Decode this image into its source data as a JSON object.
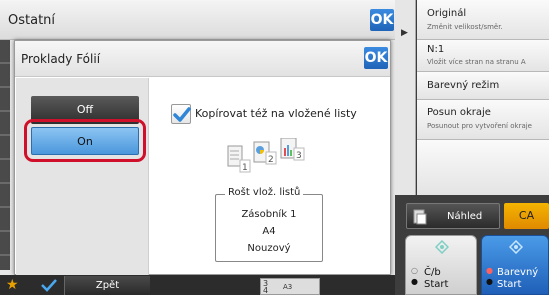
{
  "background_window": {
    "title": "Ostatní",
    "ok_label": "OK"
  },
  "dialog": {
    "title": "Proklady Fólií",
    "ok_label": "OK",
    "off_label": "Off",
    "on_label": "On",
    "checkbox_label": "Kopírovat též na vložené listy",
    "sheet_numbers": [
      "1",
      "2",
      "3"
    ],
    "tray": {
      "legend": "Rošt vlož. listů",
      "line1": "Zásobník 1",
      "line2": "A4",
      "line3": "Nouzový"
    }
  },
  "right_panel": {
    "items": [
      {
        "title": "Originál",
        "subtitle": "Změnit velikost/směr."
      },
      {
        "title": "N:1",
        "subtitle": "Vložit více stran na stranu A"
      },
      {
        "title": "Barevný režim",
        "subtitle": ""
      },
      {
        "title": "Posun okraje",
        "subtitle": "Posunout pro vytvoření okraje"
      }
    ],
    "preview_label": "Náhled",
    "ca_label": "CA",
    "start_bw_line1": "Č/b",
    "start_bw_line2": "Start",
    "start_color_line1": "Barevný",
    "start_color_line2": "Start"
  },
  "bottom_bar": {
    "back_label": "Zpět",
    "tray_label": "A3",
    "tray_numbers": [
      "3",
      "4"
    ]
  },
  "colors": {
    "accent_blue": "#2f7bd6",
    "highlight_red": "#d0102a",
    "ca_orange": "#f0a000"
  }
}
